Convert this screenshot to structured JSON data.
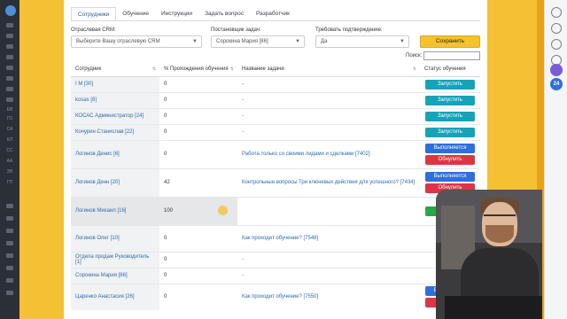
{
  "tabs": [
    {
      "label": "Сотрудники",
      "active": true
    },
    {
      "label": "Обучение",
      "active": false
    },
    {
      "label": "Инструкции",
      "active": false
    },
    {
      "label": "Задать вопрос",
      "active": false
    },
    {
      "label": "Разработчик",
      "active": false
    }
  ],
  "filters": {
    "crm_label": "Отраслевая CRM:",
    "crm_value": "Выберите Вашу отраслевую CRM",
    "setter_label": "Постановщик задач:",
    "setter_value": "Сорокина Мария [86]",
    "confirm_label": "Требовать подтверждение:",
    "confirm_value": "Да",
    "save_label": "Сохранить"
  },
  "search": {
    "label": "Поиск:",
    "value": ""
  },
  "table": {
    "headers": [
      "Сотрудник",
      "% Прохождения обучения",
      "Название задачи",
      "Статус обучения"
    ],
    "rows": [
      {
        "employee": "I M [30]",
        "percent": "0",
        "task": "-",
        "buttons": [
          "Запустить"
        ]
      },
      {
        "employee": "kosas [8]",
        "percent": "0",
        "task": "-",
        "buttons": [
          "Запустить"
        ]
      },
      {
        "employee": "КОСАС Администратор [24]",
        "percent": "0",
        "task": "-",
        "buttons": [
          "Запустить"
        ]
      },
      {
        "employee": "Кочурин Станислав [22]",
        "percent": "0",
        "task": "-",
        "buttons": [
          "Запустить"
        ]
      },
      {
        "employee": "Логинов Денис [6]",
        "percent": "0",
        "task": "Работа только со своими лидами и сделками [7402]",
        "buttons": [
          "Выполняется",
          "Обнулить"
        ]
      },
      {
        "employee": "Логинов Денн [20]",
        "percent": "42",
        "task": "Контрольные вопросы Три ключевых действия для успешного? [7434]",
        "buttons": [
          "Выполняется",
          "Обнулить"
        ]
      },
      {
        "employee": "Логинов Михаил [16]",
        "percent": "100",
        "task": "",
        "buttons": [
          "Завер"
        ]
      },
      {
        "employee": "Логинов Олег [10]",
        "percent": "0",
        "task": "Как проходит обучение? [7548]",
        "buttons": []
      },
      {
        "employee": "Отдела продаж Руководитель [1]",
        "percent": "0",
        "task": "-",
        "buttons": []
      },
      {
        "employee": "Сорокина Мария [86]",
        "percent": "0",
        "task": "-",
        "buttons": []
      },
      {
        "employee": "Царенко Анастасия [26]",
        "percent": "0",
        "task": "Как проходит обучение? [7550]",
        "buttons": [
          "Выполняется",
          "Обнулить"
        ]
      }
    ]
  },
  "left_sidebar": {
    "labels": [
      "ЕВ",
      "ГО",
      "СА",
      "КЛ",
      "СС",
      "АА",
      "ЗН",
      "ГП"
    ]
  },
  "right_sidebar": {
    "badge_count": "24"
  },
  "colors": {
    "start": "#17a2b8",
    "running": "#2f6fdb",
    "reset": "#dc3545",
    "done": "#28a745",
    "save": "#f6c12f",
    "link": "#2b6cb0",
    "background": "#f5c033"
  }
}
